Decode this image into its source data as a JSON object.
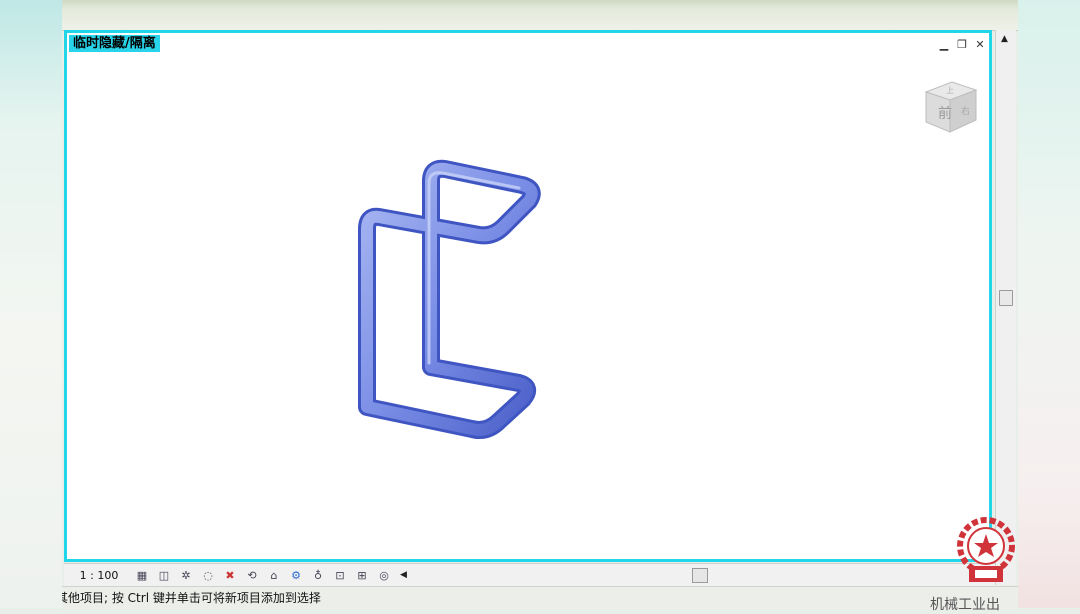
{
  "view": {
    "title": "临时隐藏/隔离"
  },
  "window_controls": {
    "minimize": "▁",
    "restore": "❐",
    "close": "✕"
  },
  "viewcube": {
    "face_label": "前",
    "top_label": "上",
    "side_label": "右"
  },
  "view_control_bar": {
    "scale": "1 : 100"
  },
  "status_bar": {
    "text": "其他项目; 按 Ctrl 键并单击可将新项目添加到选择"
  },
  "watermark": {
    "text": "机械工业出"
  },
  "colors": {
    "viewport_border": "#20d6e8",
    "title_bg": "#29d4ea",
    "pipe": "#7a8ee6",
    "pipe_dark": "#3f55c2"
  }
}
